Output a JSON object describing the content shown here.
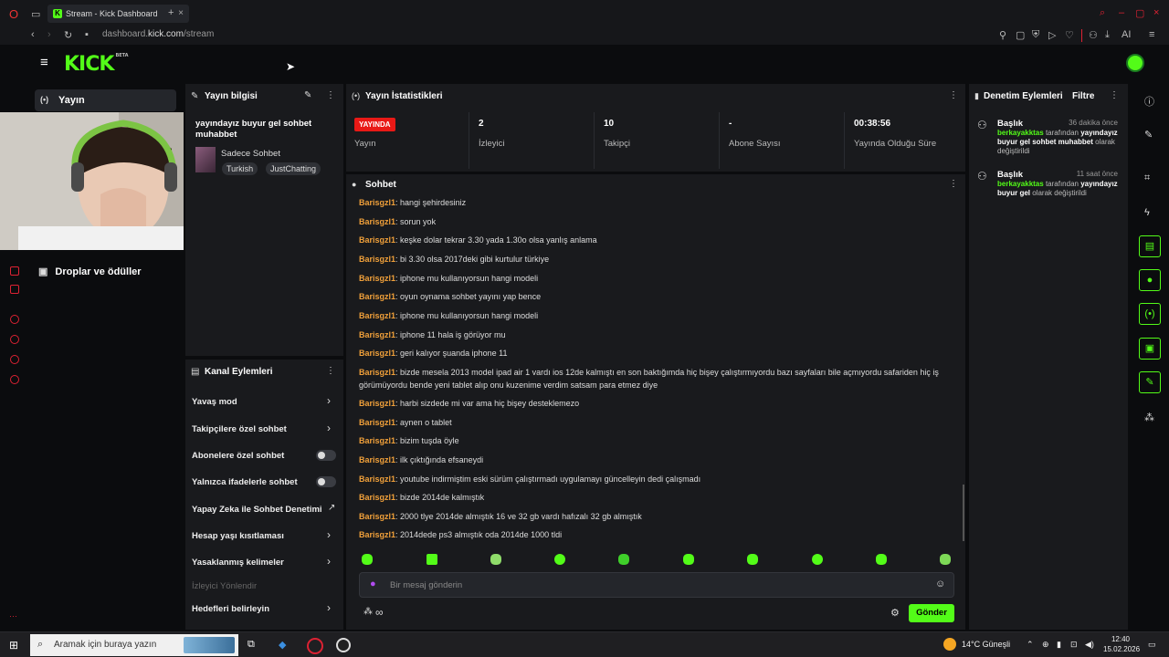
{
  "browser": {
    "tab_title": "Stream - Kick Dashboard",
    "url_prefix": "dashboard.",
    "url_domain": "kick.com",
    "url_path": "/stream",
    "ai_label": "AI"
  },
  "header": {
    "logo": "KICK",
    "logo_tag": "BETA"
  },
  "leftnav": {
    "active_item": "Yayın",
    "items": [
      "Droplar ve ödüller"
    ]
  },
  "stream_info": {
    "title": "Yayın bilgisi",
    "stream_title": "yayındayız buyur gel sohbet muhabbet",
    "category": "Sadece Sohbet",
    "tags": [
      "Turkish",
      "JustChatting"
    ]
  },
  "channel_actions": {
    "title": "Kanal Eylemleri",
    "rows": [
      {
        "label": "Yavaş mod",
        "control": "chevron"
      },
      {
        "label": "Takipçilere özel sohbet",
        "control": "chevron"
      },
      {
        "label": "Abonelere özel sohbet",
        "control": "toggle"
      },
      {
        "label": "Yalnızca ifadelerle sohbet",
        "control": "toggle"
      },
      {
        "label": "Yapay Zeka ile Sohbet Denetimi",
        "control": "external"
      },
      {
        "label": "Hesap yaşı kısıtlaması",
        "control": "chevron"
      },
      {
        "label": "Yasaklanmış kelimeler",
        "control": "chevron"
      },
      {
        "label": "İzleyici Yönlendir",
        "control": "none"
      },
      {
        "label": "Hedefleri belirleyin",
        "control": "chevron"
      }
    ]
  },
  "stats": {
    "title": "Yayın İstatistikleri",
    "live_badge": "YAYINDA",
    "items": [
      {
        "value": "",
        "label": "Yayın"
      },
      {
        "value": "2",
        "label": "İzleyici"
      },
      {
        "value": "10",
        "label": "Takipçi"
      },
      {
        "value": "-",
        "label": "Abone Sayısı"
      },
      {
        "value": "00:38:56",
        "label": "Yayında Olduğu Süre"
      }
    ]
  },
  "chat": {
    "title": "Sohbet",
    "messages": [
      {
        "user": "Barisgzl1",
        "text": "hangi şehirdesiniz"
      },
      {
        "user": "Barisgzl1",
        "text": "sorun yok"
      },
      {
        "user": "Barisgzl1",
        "text": "keşke dolar tekrar 3.30 yada 1.30o olsa yanlış anlama"
      },
      {
        "user": "Barisgzl1",
        "text": "bi 3.30 olsa 2017deki gibi kurtulur türkiye"
      },
      {
        "user": "Barisgzl1",
        "text": "iphone mu kullanıyorsun hangi modeli"
      },
      {
        "user": "Barisgzl1",
        "text": "oyun oynama sohbet yayını yap bence"
      },
      {
        "user": "Barisgzl1",
        "text": "iphone mu kullanıyorsun hangi modeli"
      },
      {
        "user": "Barisgzl1",
        "text": "iphone 11 hala iş görüyor mu"
      },
      {
        "user": "Barisgzl1",
        "text": "geri kalıyor şuanda iphone 11"
      },
      {
        "user": "Barisgzl1",
        "text": "bizde mesela 2013 model ipad air 1 vardı ios 12de kalmıştı en son baktığımda hiç bişey çalıştırmıyordu bazı sayfaları bile açmıyordu safariden hiç iş görümüyordu bende yeni tablet alıp onu kuzenime verdim satsam para etmez diye"
      },
      {
        "user": "Barisgzl1",
        "text": "harbi sizdede mi var ama hiç bişey desteklemezo"
      },
      {
        "user": "Barisgzl1",
        "text": "aynen o tablet"
      },
      {
        "user": "Barisgzl1",
        "text": "bizim tuşda öyle"
      },
      {
        "user": "Barisgzl1",
        "text": "ilk çıktığında efsaneydi"
      },
      {
        "user": "Barisgzl1",
        "text": "youtube indirmiştim eski sürüm çalıştırmadı uygulamayı güncelleyin dedi çalışmadı"
      },
      {
        "user": "Barisgzl1",
        "text": "bizde 2014de kalmıştık"
      },
      {
        "user": "Barisgzl1",
        "text": "2000 tlye 2014de almıştık 16 ve 32 gb vardı hafızalı 32 gb almıştık"
      },
      {
        "user": "Barisgzl1",
        "text": "2014dede ps3 almıştık oda 2014de 1000 tldi"
      }
    ],
    "input_placeholder": "Bir mesaj gönderin",
    "infinity": "∞",
    "send_label": "Gönder"
  },
  "moderation": {
    "title": "Denetim Eylemleri",
    "filter_label": "Filtre",
    "events": [
      {
        "title": "Başlık",
        "time": "36 dakika önce",
        "actor": "berkayakktas",
        "by": "tarafından",
        "value": "yayındayız buyur gel sohbet muhabbet",
        "suffix": "olarak değiştirildi"
      },
      {
        "title": "Başlık",
        "time": "11 saat önce",
        "actor": "berkayakktas",
        "by": "tarafından",
        "value": "yayındayız buyur gel",
        "suffix": "olarak değiştirildi"
      }
    ]
  },
  "taskbar": {
    "search_placeholder": "Aramak için buraya yazın",
    "weather": "14°C  Güneşli",
    "time": "12:40",
    "date": "15.02.2026"
  },
  "colors": {
    "accent": "#53fc18",
    "live": "#e91916",
    "username": "#f0a03a"
  }
}
